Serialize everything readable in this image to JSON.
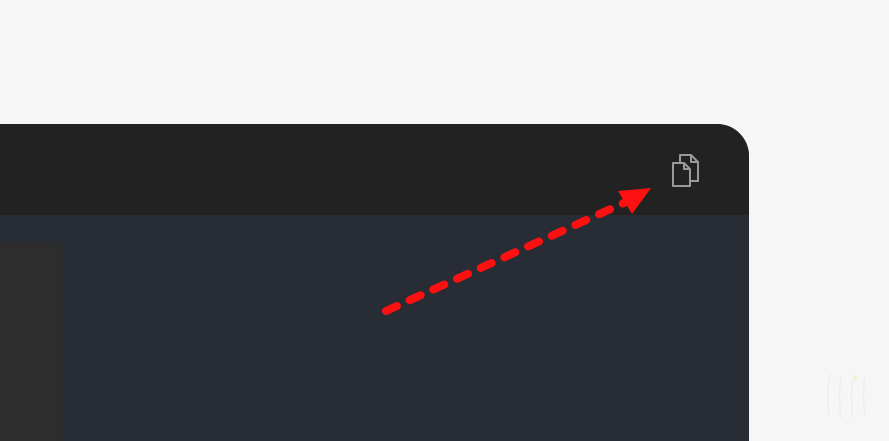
{
  "page": {
    "background": "#f6f6f6"
  },
  "code_block": {
    "header_color": "#222222",
    "body_color": "#282c34",
    "gutter_color": "#2d2d2d",
    "copy_button": {
      "icon": "copy-icon",
      "color": "#9a9a9a"
    }
  },
  "annotation": {
    "type": "dashed-arrow",
    "color": "#ff1010",
    "target": "copy-button"
  }
}
